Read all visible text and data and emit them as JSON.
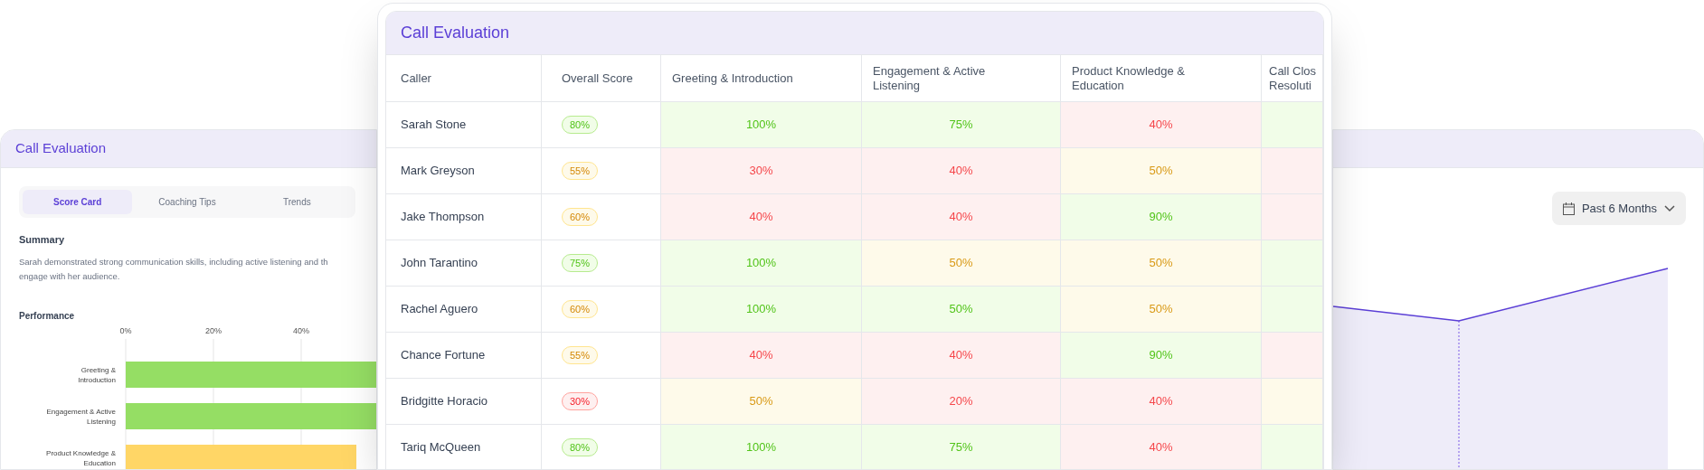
{
  "score_card": {
    "title": "Call Evaluation",
    "tabs": [
      {
        "label": "Score Card",
        "selected": true
      },
      {
        "label": "Coaching Tips",
        "selected": false
      },
      {
        "label": "Trends",
        "selected": false
      }
    ],
    "summary": {
      "heading": "Summary",
      "lines": [
        "Sarah demonstrated strong communication skills, including active listening and th",
        "engage with her audience."
      ]
    },
    "performance": {
      "heading": "Performance",
      "axis_labels": [
        "0%",
        "20%",
        "40%"
      ],
      "categories": [
        "Greeting & Introduction",
        "Engagement & Active Listening",
        "Product Knowledge & Education"
      ]
    }
  },
  "evaluation_table": {
    "title": "Call Evaluation",
    "columns": [
      "Caller",
      "Overall Score",
      "Greeting & Introduction",
      "Engagement & Active Listening",
      "Product Knowledge & Education",
      "Call Clos Resoluti"
    ],
    "rows": [
      {
        "caller": "Sarah Stone",
        "overall": {
          "value": "80%",
          "color": "#f1fde8"
        },
        "scores": [
          {
            "value": "100%",
            "color": "#f1fde8"
          },
          {
            "value": "75%",
            "color": "#f1fde8"
          },
          {
            "value": "40%",
            "color": "#fef0f0"
          },
          {
            "color": "#f1fde8"
          }
        ]
      },
      {
        "caller": "Mark Greyson",
        "overall": {
          "value": "55%",
          "color": "#fefaea"
        },
        "scores": [
          {
            "value": "30%",
            "color": "#fef0f0"
          },
          {
            "value": "40%",
            "color": "#fef0f0"
          },
          {
            "value": "50%",
            "color": "#fefaea"
          },
          {
            "color": "#fef0f0"
          }
        ]
      },
      {
        "caller": "Jake Thompson",
        "overall": {
          "value": "60%",
          "color": "#fefaea"
        },
        "scores": [
          {
            "value": "40%",
            "color": "#fef0f0"
          },
          {
            "value": "40%",
            "color": "#fef0f0"
          },
          {
            "value": "90%",
            "color": "#f1fde8"
          },
          {
            "color": "#fef0f0"
          }
        ]
      },
      {
        "caller": "John Tarantino",
        "overall": {
          "value": "75%",
          "color": "#f1fde8"
        },
        "scores": [
          {
            "value": "100%",
            "color": "#f1fde8"
          },
          {
            "value": "50%",
            "color": "#fefaea"
          },
          {
            "value": "50%",
            "color": "#fefaea"
          },
          {
            "color": "#f1fde8"
          }
        ]
      },
      {
        "caller": "Rachel Aguero",
        "overall": {
          "value": "60%",
          "color": "#fefaea"
        },
        "scores": [
          {
            "value": "100%",
            "color": "#f1fde8"
          },
          {
            "value": "50%",
            "color": "#f1fde8"
          },
          {
            "value": "50%",
            "color": "#fefaea"
          },
          {
            "color": "#f1fde8"
          }
        ]
      },
      {
        "caller": "Chance Fortune",
        "overall": {
          "value": "55%",
          "color": "#fefaea"
        },
        "scores": [
          {
            "value": "40%",
            "color": "#fef0f0"
          },
          {
            "value": "40%",
            "color": "#fef0f0"
          },
          {
            "value": "90%",
            "color": "#f1fde8"
          },
          {
            "color": "#fef0f0"
          }
        ]
      },
      {
        "caller": "Bridgitte Horacio",
        "overall": {
          "value": "30%",
          "color": "#fef0f0"
        },
        "scores": [
          {
            "value": "50%",
            "color": "#fefaea"
          },
          {
            "value": "20%",
            "color": "#fef0f0"
          },
          {
            "value": "40%",
            "color": "#fef0f0"
          },
          {
            "color": "#fefaea"
          }
        ]
      },
      {
        "caller": "Tariq McQueen",
        "overall": {
          "value": "80%",
          "color": "#f1fde8"
        },
        "scores": [
          {
            "value": "100%",
            "color": "#f1fde8"
          },
          {
            "value": "75%",
            "color": "#f1fde8"
          },
          {
            "value": "40%",
            "color": "#fef0f0"
          },
          {
            "color": "#f1fde8"
          }
        ]
      }
    ]
  },
  "trends_card": {
    "period_dropdown": {
      "value": "Past 6 Months"
    }
  }
}
